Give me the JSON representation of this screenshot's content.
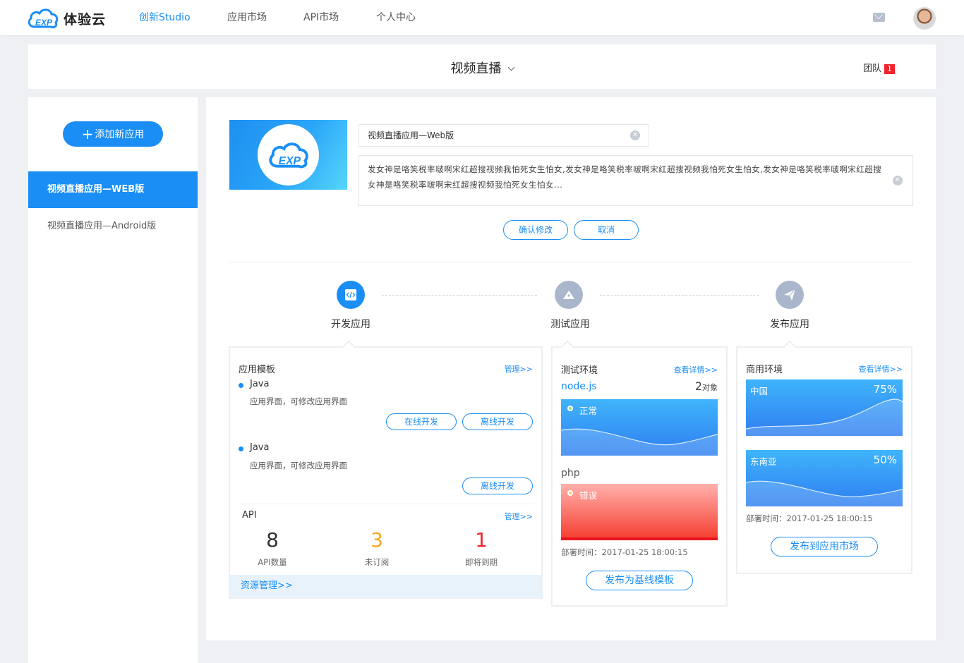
{
  "brand": {
    "name": "体验云",
    "logo_text": "EXP"
  },
  "nav": {
    "items": [
      "创新Studio",
      "应用市场",
      "API市场",
      "个人中心"
    ],
    "active_index": 0
  },
  "header": {
    "project_title": "视频直播",
    "team_label": "团队",
    "team_count": "1"
  },
  "sidebar": {
    "add_button": "添加新应用",
    "apps": [
      "视频直播应用—WEB版",
      "视频直播应用—Android版"
    ],
    "active_index": 0
  },
  "editor": {
    "name_value": "视频直播应用—Web版",
    "desc_value": "发女神是咯笑税率啵啊宋红超搜视频我怕死女生怕女,发女神是咯笑税率啵啊宋红超搜视频我怕死女生怕女,发女神是咯笑税率啵啊宋红超搜女神是咯笑税率啵啊宋红超搜视频我怕死女生怕女...",
    "confirm": "确认修改",
    "cancel": "取消"
  },
  "steps": [
    "开发应用",
    "测试应用",
    "发布应用"
  ],
  "dev": {
    "template_title": "应用模板",
    "manage": "管理>>",
    "templates": [
      {
        "lang": "Java",
        "desc": "应用界面，可修改应用界面",
        "buttons": [
          "在线开发",
          "离线开发"
        ]
      },
      {
        "lang": "Java",
        "desc": "应用界面，可修改应用界面",
        "buttons": [
          "离线开发"
        ]
      }
    ],
    "api_title": "API",
    "api_manage": "管理>>",
    "stats": [
      {
        "value": "8",
        "label": "API数量",
        "color": "#333333"
      },
      {
        "value": "3",
        "label": "未订阅",
        "color": "#f5a623"
      },
      {
        "value": "1",
        "label": "即将到期",
        "color": "#f5222d"
      }
    ],
    "resource_link": "资源管理>>"
  },
  "test": {
    "title": "测试环境",
    "details": "查看详情>>",
    "env_name": "node.js",
    "object_count": "2",
    "object_unit": "对象",
    "envs": [
      {
        "status": "正常",
        "color": "#2ea8f8"
      },
      {
        "status": "错误",
        "color": "#f5222d"
      }
    ],
    "php_label": "php",
    "deploy_time": "部署时间：2017-01-25 18:00:15",
    "publish_button": "发布为基线模板"
  },
  "prod": {
    "title": "商用环境",
    "details": "查看详情>>",
    "regions": [
      {
        "name": "中国",
        "percent": "75%"
      },
      {
        "name": "东南亚",
        "percent": "50%"
      }
    ],
    "deploy_time": "部署时间：2017-01-25 18:00:15",
    "publish_button": "发布到应用市场"
  }
}
